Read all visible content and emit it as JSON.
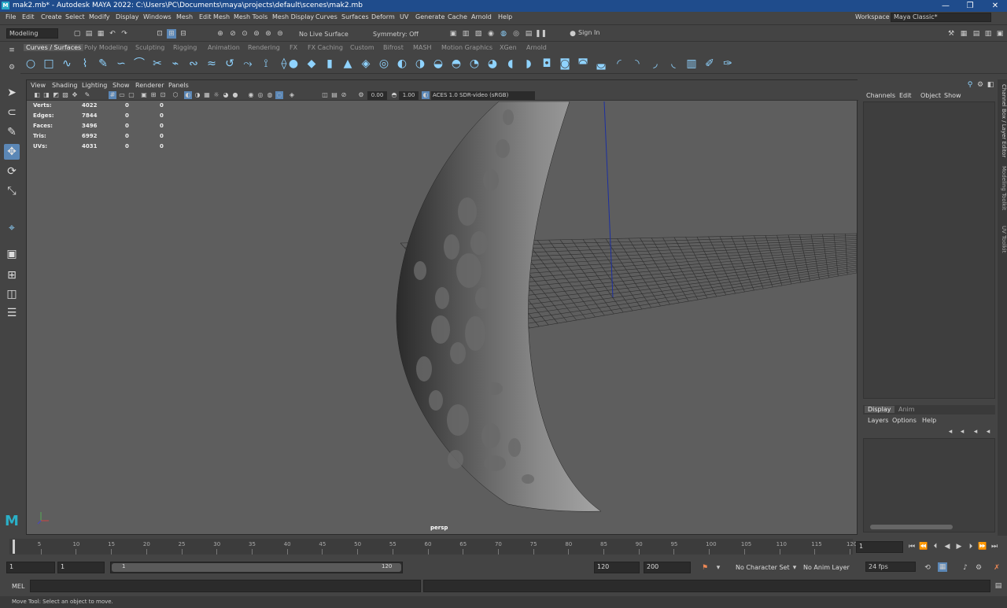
{
  "window": {
    "title": "mak2.mb* - Autodesk MAYA 2022: C:\\Users\\PC\\Documents\\maya\\projects\\default\\scenes\\mak2.mb",
    "logo": "M",
    "minimize": "—",
    "maximize": "❐",
    "close": "✕"
  },
  "menubar": {
    "items": [
      "File",
      "Edit",
      "Create",
      "Select",
      "Modify",
      "Display",
      "Windows",
      "Mesh",
      "Edit Mesh",
      "Mesh Tools",
      "Mesh Display",
      "Curves",
      "Surfaces",
      "Deform",
      "UV",
      "Generate",
      "Cache",
      "Arnold",
      "Help"
    ],
    "workspace_label": "Workspace :",
    "workspace_value": "Maya Classic*"
  },
  "statusline": {
    "mode": "Modeling",
    "live_surface": "No Live Surface",
    "symmetry": "Symmetry: Off",
    "sign_in": "Sign In"
  },
  "shelf": {
    "tabs": [
      "Curves / Surfaces",
      "Poly Modeling",
      "Sculpting",
      "Rigging",
      "Animation",
      "Rendering",
      "FX",
      "FX Caching",
      "Custom",
      "Bifrost",
      "MASH",
      "Motion Graphics",
      "XGen",
      "Arnold"
    ],
    "active_tab": "Curves / Surfaces"
  },
  "viewport": {
    "menus": [
      "View",
      "Shading",
      "Lighting",
      "Show",
      "Renderer",
      "Panels"
    ],
    "exposure": "0.00",
    "gamma": "1.00",
    "color_space": "ACES 1.0 SDR-video (sRGB)",
    "camera": "persp",
    "hud": [
      {
        "label": "Verts:",
        "v1": "4022",
        "v2": "0",
        "v3": "0"
      },
      {
        "label": "Edges:",
        "v1": "7844",
        "v2": "0",
        "v3": "0"
      },
      {
        "label": "Faces:",
        "v1": "3496",
        "v2": "0",
        "v3": "0"
      },
      {
        "label": "Tris:",
        "v1": "6992",
        "v2": "0",
        "v3": "0"
      },
      {
        "label": "UVs:",
        "v1": "4031",
        "v2": "0",
        "v3": "0"
      }
    ]
  },
  "channelbox": {
    "menus": [
      "Channels",
      "Edit",
      "Object",
      "Show"
    ],
    "layer_tabs": [
      "Display",
      "Anim"
    ],
    "layer_menus": [
      "Layers",
      "Options",
      "Help"
    ]
  },
  "sidetabs": [
    "Channel Box / Layer Editor",
    "Modeling Toolkit",
    "UV Toolkit"
  ],
  "timeline": {
    "ticks": [
      "5",
      "10",
      "15",
      "20",
      "25",
      "30",
      "35",
      "40",
      "45",
      "50",
      "55",
      "60",
      "65",
      "70",
      "75",
      "80",
      "85",
      "90",
      "95",
      "100",
      "105",
      "110",
      "115",
      "120"
    ],
    "current_frame": "1"
  },
  "range": {
    "start": "1",
    "playback_start": "1",
    "slider_start": "1",
    "slider_end": "120",
    "playback_end": "120",
    "end": "200",
    "character_set": "No Character Set",
    "anim_layer": "No Anim Layer",
    "fps": "24 fps"
  },
  "cmdline": {
    "label": "MEL"
  },
  "helpline": {
    "text": "Move Tool: Select an object to move."
  }
}
